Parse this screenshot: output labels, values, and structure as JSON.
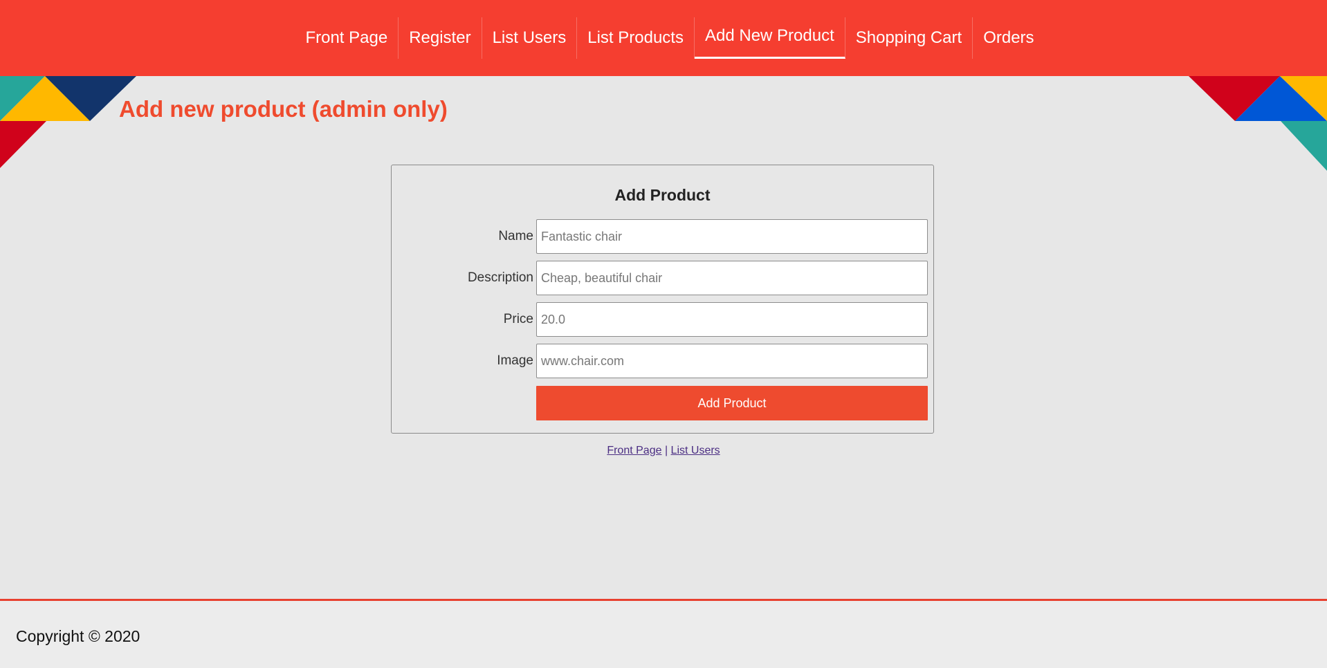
{
  "nav": {
    "items": [
      {
        "label": "Front Page",
        "active": false
      },
      {
        "label": "Register",
        "active": false
      },
      {
        "label": "List Users",
        "active": false
      },
      {
        "label": "List Products",
        "active": false
      },
      {
        "label": "Add New Product",
        "active": true
      },
      {
        "label": "Shopping Cart",
        "active": false
      },
      {
        "label": "Orders",
        "active": false
      }
    ]
  },
  "page": {
    "title": "Add new product (admin only)"
  },
  "form": {
    "title": "Add Product",
    "fields": [
      {
        "label": "Name",
        "value": "",
        "placeholder": "Fantastic chair"
      },
      {
        "label": "Description",
        "value": "",
        "placeholder": "Cheap, beautiful chair"
      },
      {
        "label": "Price",
        "value": "",
        "placeholder": "20.0"
      },
      {
        "label": "Image",
        "value": "",
        "placeholder": "www.chair.com"
      }
    ],
    "submit_label": "Add Product"
  },
  "links": {
    "front_page": "Front Page",
    "separator": "|",
    "list_users": "List Users"
  },
  "footer": {
    "copyright": "Copyright © 2020"
  },
  "colors": {
    "nav_background": "#f53e30",
    "accent": "#ee4b2f",
    "page_background": "#e7e7e7",
    "link": "#4b2e83",
    "decor_teal": "#26a69a",
    "decor_yellow": "#ffb800",
    "decor_navy": "#12346b",
    "decor_red": "#d0021b",
    "decor_blue": "#0057d6"
  }
}
